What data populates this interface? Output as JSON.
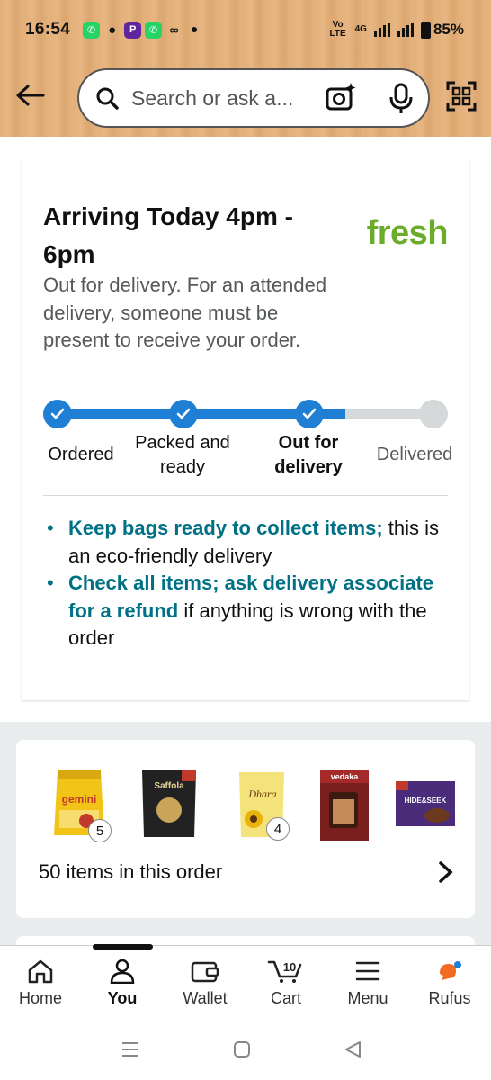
{
  "status_bar": {
    "time": "16:54",
    "network_tag": "Vo LTE",
    "network_type": "4G",
    "battery": "85%"
  },
  "header": {
    "search_placeholder": "Search or ask a..."
  },
  "delivery": {
    "title": "Arriving Today 4pm - 6pm",
    "brand": "fresh",
    "description": "Out for delivery. For an attended delivery, someone must be present to receive your order.",
    "steps": [
      {
        "label": "Ordered",
        "state": "done"
      },
      {
        "label": "Packed and ready",
        "state": "done"
      },
      {
        "label": "Out for delivery",
        "state": "current"
      },
      {
        "label": "Delivered",
        "state": "pending"
      }
    ],
    "tips": [
      {
        "link": "Keep bags ready to collect items;",
        "text": " this is an eco-friendly delivery"
      },
      {
        "link": "Check all items; ask delivery associate for a refund",
        "text": " if anything is wrong with the order"
      }
    ]
  },
  "order_items": {
    "thumbnails": [
      {
        "name": "gemini",
        "qty": "5"
      },
      {
        "name": "Saffola",
        "qty": ""
      },
      {
        "name": "Dhara",
        "qty": "4"
      },
      {
        "name": "vedaka",
        "qty": ""
      },
      {
        "name": "HIDE&SEEK",
        "qty": ""
      }
    ],
    "count_label": "50 items in this order"
  },
  "bottom_nav": {
    "items": [
      {
        "label": "Home",
        "icon": "home-icon"
      },
      {
        "label": "You",
        "icon": "user-icon",
        "active": true
      },
      {
        "label": "Wallet",
        "icon": "wallet-icon"
      },
      {
        "label": "Cart",
        "icon": "cart-icon",
        "badge": "10"
      },
      {
        "label": "Menu",
        "icon": "menu-icon"
      },
      {
        "label": "Rufus",
        "icon": "rufus-icon"
      }
    ]
  },
  "colors": {
    "accent_blue": "#1e7fd4",
    "link_teal": "#007185",
    "fresh_green": "#6bad2a"
  }
}
